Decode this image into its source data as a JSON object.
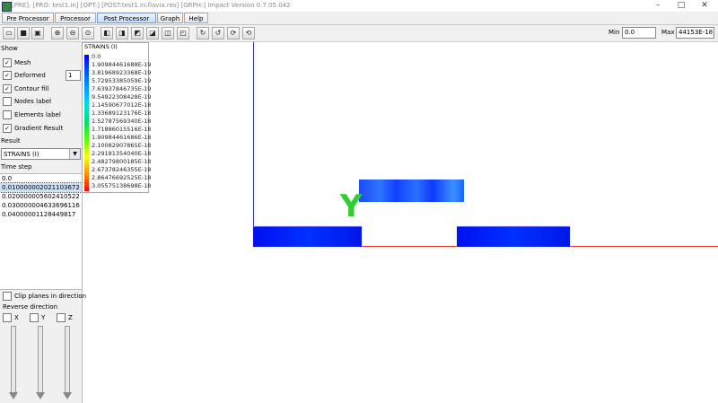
{
  "window": {
    "title": "[PRE]: [PRO: test1.in] [OPT:] [POST:test1.in.flavia.res] [GRPH:] Impact Version 0.7.05.042",
    "buttons": {
      "minimize": "–",
      "maximize": "□",
      "close": "✕"
    }
  },
  "menu": {
    "items": [
      {
        "label": "Pre Processor",
        "active": false
      },
      {
        "label": "Processor",
        "active": false
      },
      {
        "label": "Post Processor",
        "active": true
      },
      {
        "label": "Graph",
        "active": false
      },
      {
        "label": "Help",
        "active": false
      }
    ]
  },
  "toolbar": {
    "icons": [
      "open-icon",
      "save-icon",
      "save-as-icon",
      "zoom-in-icon",
      "zoom-out-icon",
      "zoom-fit-icon",
      "view-front-icon",
      "view-back-icon",
      "view-left-icon",
      "view-right-icon",
      "view-top-icon",
      "view-bottom-icon",
      "rotate-x-icon",
      "rotate-y-icon",
      "rotate-z-icon",
      "reset-view-icon"
    ],
    "min_label": "Min",
    "min_value": "0.0",
    "max_label": "Max",
    "max_value": "44153E-18"
  },
  "panel": {
    "show_label": "Show",
    "mesh_label": "Mesh",
    "deformed_label": "Deformed",
    "deformed_value": "1",
    "contour_label": "Contour fill",
    "nodes_label": "Nodes label",
    "elements_label": "Elements label",
    "gradient_label": "Gradient Result",
    "result_label": "Result",
    "result_value": "STRAINS (I)",
    "timestep_label": "Time step",
    "timesteps": [
      "0.0",
      "0.010000002021103672",
      "0.020000005602410522",
      "0.030000004633696116",
      "0.04000001128449817"
    ],
    "clip_label": "Clip planes in direction",
    "reverse_label": "Reverse direction",
    "axes": [
      "X",
      "Y",
      "Z"
    ]
  },
  "legend": {
    "title": "STRAINS (I)",
    "values": [
      "0.0",
      "1.90984461688E-19",
      "3.81968923368E-19",
      "5.72953385059E-19",
      "7.63937846735E-19",
      "9.54922308428E-19",
      "1.14590677012E-18",
      "1.33689123176E-18",
      "1.52787569340E-18",
      "1.71886015516E-18",
      "1.90984461686E-18",
      "2.10082907865E-18",
      "2.29181354040E-18",
      "2.48279800185E-18",
      "2.67378246355E-18",
      "2.86476692525E-18",
      "3.05575138698E-18"
    ]
  },
  "viewport": {
    "axis_label": "Y",
    "colors": {
      "vertical_axis": "#3333aa",
      "horizontal_axis": "#ee3333",
      "mesh": "#0020ff",
      "axis_label": "#33cc33"
    }
  }
}
